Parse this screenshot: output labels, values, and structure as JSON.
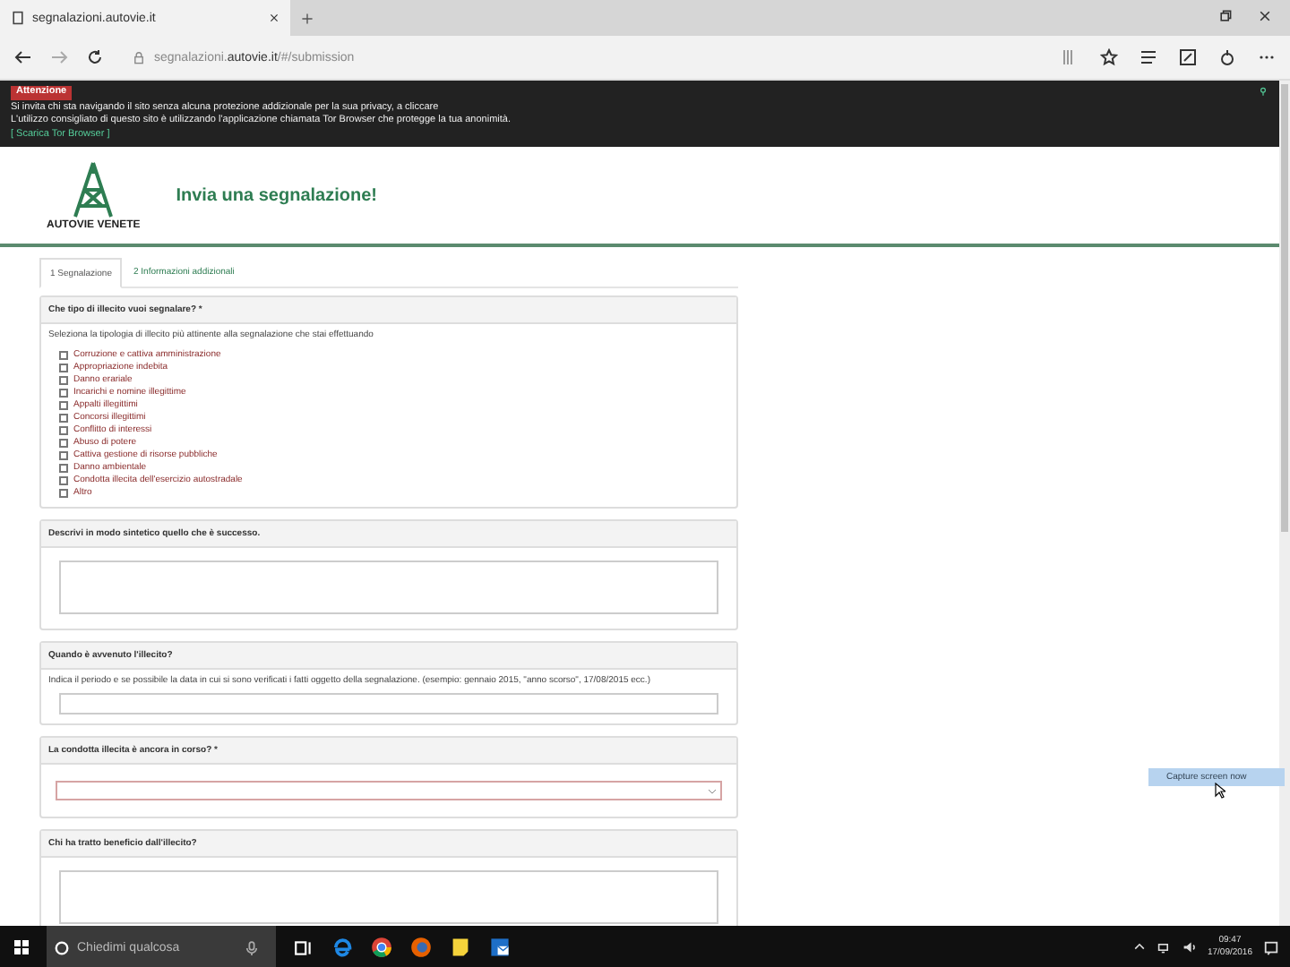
{
  "browser": {
    "tab_title": "segnalazioni.autovie.it",
    "url_host": "segnalazioni.",
    "url_domain": "autovie.it",
    "url_path": "/#/submission"
  },
  "notice": {
    "badge": "Attenzione",
    "lines": [
      "Si invita chi sta navigando il sito senza alcuna protezione addizionale per la sua privacy, a cliccare",
      "L'utilizzo consigliato di questo sito è utilizzando l'applicazione chiamata Tor Browser che protegge la tua anonimità."
    ],
    "link": "[ Scarica Tor Browser ]"
  },
  "header": {
    "logo_text": "AUTOVIE VENETE",
    "title": "Invia una segnalazione!"
  },
  "steps": [
    {
      "label": "1  Segnalazione",
      "selected": true
    },
    {
      "label": "2  Informazioni addizionali",
      "selected": false
    }
  ],
  "questions": [
    {
      "kind": "checkboxes",
      "title": "Che tipo di illecito vuoi segnalare? *",
      "hint": "Seleziona la tipologia di illecito più attinente alla segnalazione che stai effettuando",
      "options": [
        {
          "label": "Corruzione e cattiva amministrazione",
          "checked": false
        },
        {
          "label": "Appropriazione indebita",
          "checked": false
        },
        {
          "label": "Danno erariale",
          "checked": false
        },
        {
          "label": "Incarichi e nomine illegittime",
          "checked": false
        },
        {
          "label": "Appalti illegittimi",
          "checked": false
        },
        {
          "label": "Concorsi illegittimi",
          "checked": false
        },
        {
          "label": "Conflitto di interessi",
          "checked": false
        },
        {
          "label": "Abuso di potere",
          "checked": false
        },
        {
          "label": "Cattiva gestione di risorse pubbliche",
          "checked": false
        },
        {
          "label": "Danno ambientale",
          "checked": false
        },
        {
          "label": "Condotta illecita dell'esercizio autostradale",
          "checked": false
        },
        {
          "label": "Altro",
          "checked": false
        }
      ]
    },
    {
      "kind": "textarea",
      "title": "Descrivi in modo sintetico quello che è successo."
    },
    {
      "kind": "input",
      "title": "Quando è avvenuto l'illecito?",
      "hint": "Indica il periodo e se possibile la data in cui si sono verificati i fatti oggetto della segnalazione. (esempio: gennaio 2015, \"anno scorso\", 17/08/2015 ecc.)"
    },
    {
      "kind": "select",
      "title": "La condotta illecita è ancora in corso? *"
    },
    {
      "kind": "textarea",
      "title": "Chi ha tratto beneficio dall'illecito?"
    }
  ],
  "tooltip": "Capture screen now",
  "taskbar": {
    "search_placeholder": "Chiedimi qualcosa",
    "time": "09:47",
    "date": "17/09/2016"
  }
}
